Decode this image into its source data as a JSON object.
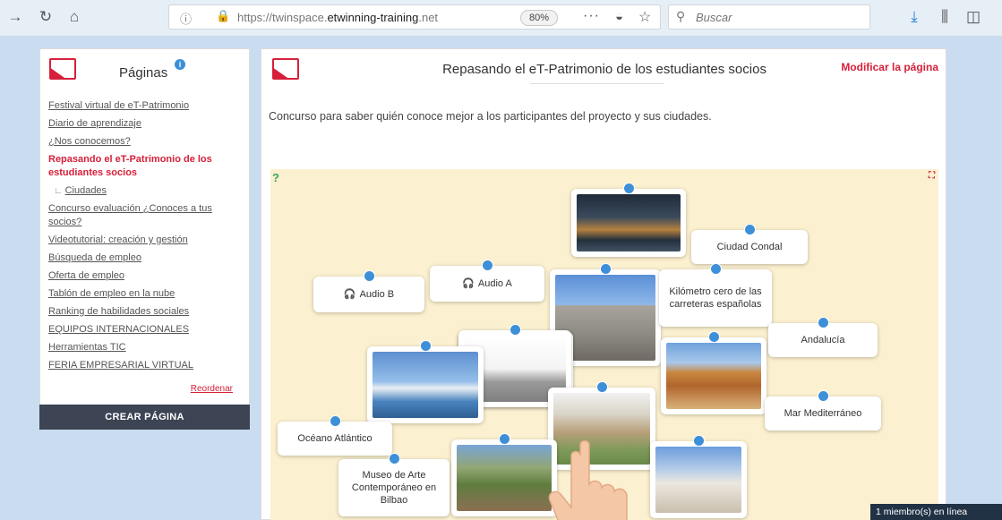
{
  "browser": {
    "url_prefix": "https://twinspace.",
    "url_domain": "etwinning-training",
    "url_suffix": ".net",
    "zoom": "80%",
    "search_placeholder": "Buscar"
  },
  "sidebar": {
    "title": "Páginas",
    "items": [
      {
        "label": "Festival virtual de eT-Patrimonio"
      },
      {
        "label": "Diario de aprendizaje"
      },
      {
        "label": "¿Nos conocemos?"
      },
      {
        "label": "Repasando el eT-Patrimonio de los estudiantes socios"
      },
      {
        "label": "Ciudades"
      },
      {
        "label": "Concurso evaluación ¿Conoces a tus socios?"
      },
      {
        "label": "Videotutorial: creación y gestión"
      },
      {
        "label": "Búsqueda de empleo"
      },
      {
        "label": "Oferta de empleo"
      },
      {
        "label": "Tablón de empleo en la nube"
      },
      {
        "label": "Ranking de habilidades sociales"
      },
      {
        "label": "EQUIPOS INTERNACIONALES"
      },
      {
        "label": "Herramientas TIC"
      },
      {
        "label": "FERIA EMPRESARIAL VIRTUAL"
      }
    ],
    "reorder_label": "Reordenar",
    "create_button": "CREAR PÁGINA"
  },
  "main": {
    "title": "Repasando el eT-Patrimonio de los estudiantes socios",
    "modify_label": "Modificar la página",
    "description": "Concurso para saber quién conoce mejor a los participantes del proyecto y sus ciudades."
  },
  "game": {
    "cards": {
      "ciudad_condal": "Ciudad Condal",
      "audio_b": "Audio B",
      "audio_a": "Audio A",
      "kilometro_cero": "Kilómetro cero de las carreteras españolas",
      "andalucia": "Andalucía",
      "mar_mediterraneo": "Mar Mediterráneo",
      "oceano_atlantico": "Océano Atlántico",
      "museo_bilbao": "Museo de Arte Contemporáneo en Bilbao"
    }
  },
  "status": {
    "online": "1 miembro(s) en línea"
  },
  "icons": {
    "back": "arrow-right-icon",
    "reload": "reload-icon",
    "home": "home-icon",
    "download": "download-icon",
    "library": "library-icon",
    "sidebar_toggle": "sidebar-icon"
  },
  "colors": {
    "accent_red": "#d6203a",
    "pin_blue": "#3d8fd8",
    "create_button_bg": "#3d4454",
    "game_bg": "#fbf0cf"
  }
}
